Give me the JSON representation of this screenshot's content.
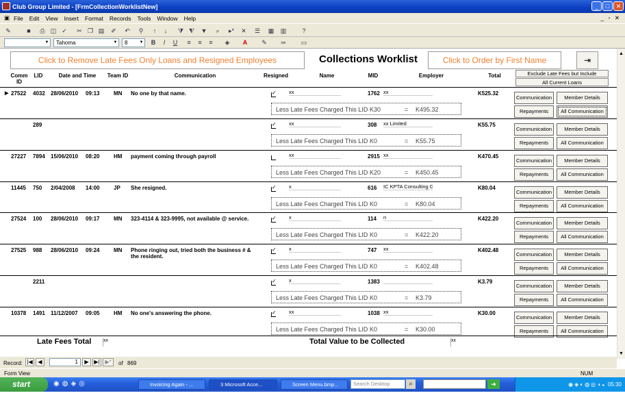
{
  "window": {
    "title": "Club Group Limited - [FrmCollectionWorklistNew]",
    "min": "_",
    "max": "□",
    "close": "✕"
  },
  "menu": [
    "File",
    "Edit",
    "View",
    "Insert",
    "Format",
    "Records",
    "Tools",
    "Window",
    "Help"
  ],
  "mdi_controls": "_ ▫ ✕",
  "format": {
    "font": "Tahoma",
    "size": "8",
    "bold": "B",
    "italic": "I",
    "underline": "U"
  },
  "form": {
    "remove_btn": "Click to Remove Late Fees Only Loans and Resigned Employees",
    "title": "Collections Worklist",
    "order_btn": "Click to Order by First Name",
    "exclude_btn": "Exclude Late Fees but Include",
    "all_current_btn": "All Current Loans",
    "headers": {
      "comm_id": "Comm ID",
      "lid": "LID",
      "date_time": "Date and Time",
      "team_id": "Team ID",
      "communication": "Communication",
      "resigned": "Resigned",
      "name": "Name",
      "mid": "MID",
      "employer": "Employer",
      "total": "Total"
    },
    "late_label": "Less Late Fees Charged This LID",
    "btn_communication": "Communication",
    "btn_member": "Member Details",
    "btn_repayments": "Repayments",
    "btn_all_comm": "All Communication",
    "rows": [
      {
        "comm_id": "27522",
        "lid": "4032",
        "date": "28/06/2010",
        "time": "09:13",
        "team": "MN",
        "comm": "No one by that name.",
        "resigned": true,
        "name": "xx",
        "mid": "1762",
        "employer": "xx",
        "total": "K525.32",
        "late_fee": "K30",
        "net": "K495.32"
      },
      {
        "comm_id": "",
        "lid": "289",
        "date": "",
        "time": "",
        "team": "",
        "comm": "",
        "resigned": true,
        "name": "xx",
        "mid": "308",
        "employer": "xx Limited",
        "total": "K55.75",
        "late_fee": "K0",
        "net": "K55.75"
      },
      {
        "comm_id": "27227",
        "lid": "7894",
        "date": "15/06/2010",
        "time": "08:20",
        "team": "HM",
        "comm": "payment coming through payroll",
        "resigned": false,
        "name": "xx",
        "mid": "2915",
        "employer": "xx",
        "total": "K470.45",
        "late_fee": "K20",
        "net": "K450.45"
      },
      {
        "comm_id": "11445",
        "lid": "750",
        "date": "2/04/2008",
        "time": "14:00",
        "team": "JP",
        "comm": "She resigned.",
        "resigned": true,
        "name": "x",
        "mid": "616",
        "employer": "IC KPTA Consulting Group",
        "total": "K80.04",
        "late_fee": "K0",
        "net": "K80.04"
      },
      {
        "comm_id": "27524",
        "lid": "100",
        "date": "28/06/2010",
        "time": "09:17",
        "team": "MN",
        "comm": "323-4114 & 323-9995, not available @ service.",
        "resigned": true,
        "name": "x",
        "mid": "114",
        "employer": "n",
        "total": "K422.20",
        "late_fee": "K0",
        "net": "K422.20"
      },
      {
        "comm_id": "27525",
        "lid": "988",
        "date": "28/06/2010",
        "time": "09:24",
        "team": "MN",
        "comm": "Phone ringing out, tried both the business # & the resident.",
        "resigned": true,
        "name": "x",
        "mid": "747",
        "employer": "xx",
        "total": "K402.48",
        "late_fee": "K0",
        "net": "K402.48"
      },
      {
        "comm_id": "",
        "lid": "2211",
        "date": "",
        "time": "",
        "team": "",
        "comm": "",
        "resigned": true,
        "name": "x",
        "mid": "1383",
        "employer": "",
        "total": "K3.79",
        "late_fee": "K0",
        "net": "K3.79"
      },
      {
        "comm_id": "10378",
        "lid": "1491",
        "date": "11/12/2007",
        "time": "09:05",
        "team": "HM",
        "comm": "No one's answering the phone.",
        "resigned": true,
        "name": "xx",
        "mid": "1038",
        "employer": "xx",
        "total": "K30.00",
        "late_fee": "K0",
        "net": "K30.00"
      }
    ],
    "late_fees_total_label": "Late Fees Total",
    "late_fees_total_value": "xx",
    "total_value_label": "Total Value to be Collected",
    "total_value_value": "xx"
  },
  "nav": {
    "record_label": "Record:",
    "current": "1",
    "of_label": "of",
    "count": "869"
  },
  "status": {
    "view": "Form View",
    "num": "NUM"
  },
  "taskbar": {
    "start": "start",
    "tasks": [
      "Invoicing Again - ...",
      "3 Microsoft Acce...",
      "Screen Menu.bmp..."
    ],
    "search": "Search Desktop",
    "clock": "05:30"
  }
}
